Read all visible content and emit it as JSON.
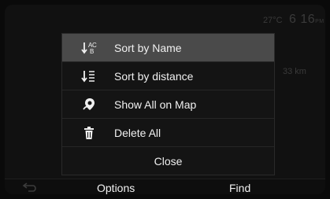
{
  "status": {
    "temperature": "27°C",
    "time": "6 16",
    "ampm": "PM"
  },
  "background": {
    "distance": "33 km"
  },
  "menu": {
    "items": [
      {
        "label": "Sort by Name",
        "icon": "sort-alpha-icon",
        "selected": true
      },
      {
        "label": "Sort by distance",
        "icon": "sort-list-icon",
        "selected": false
      },
      {
        "label": "Show All on Map",
        "icon": "map-pin-icon",
        "selected": false
      },
      {
        "label": "Delete All",
        "icon": "trash-icon",
        "selected": false
      }
    ],
    "close_label": "Close"
  },
  "bottom_bar": {
    "back_icon": "back-arrow-icon",
    "options_label": "Options",
    "find_label": "Find"
  },
  "colors": {
    "selected_bg": "#4a4a4a",
    "menu_bg": "#141414",
    "text": "#f0f0f0",
    "dim_text": "#3a3a3a"
  }
}
